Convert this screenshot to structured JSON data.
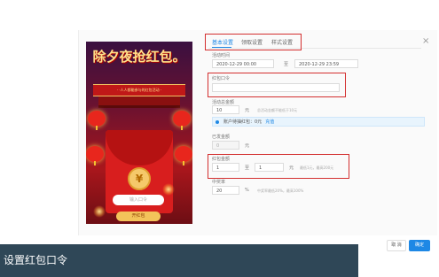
{
  "preview": {
    "title": "除夕夜抢红包。",
    "ribbon_text": "· ·人人都能参与的红包活动 ·",
    "coin_symbol": "¥",
    "password_placeholder": "输入口令",
    "open_button": "开红包"
  },
  "tabs": [
    {
      "label": "基本设置",
      "active": true
    },
    {
      "label": "领取设置",
      "active": false
    },
    {
      "label": "样式设置",
      "active": false
    }
  ],
  "form": {
    "activity_time": {
      "label": "活动时间",
      "start": "2020-12-29 00:00",
      "separator": "至",
      "end": "2020-12-29 23:59"
    },
    "red_packet_password": {
      "label": "红包口令",
      "value": ""
    },
    "activity_amount": {
      "label": "活动总金额",
      "value": "10",
      "unit": "元",
      "hint": "总活动金额不能低于10元"
    },
    "account_info": {
      "text": "账户待抽红包：0元",
      "link": "充值"
    },
    "issued_amount": {
      "label": "已发金额",
      "value": "0",
      "unit": "元"
    },
    "red_packet_amount": {
      "label": "红包金额",
      "min": "1",
      "separator": "至",
      "max": "1",
      "unit": "元",
      "hint": "最低1元，最高200元"
    },
    "win_rate": {
      "label": "中奖率",
      "value": "20",
      "unit": "%",
      "hint": "中奖率最低20%，最高100%"
    }
  },
  "buttons": {
    "cancel": "取 消",
    "ok": "确定"
  },
  "close_symbol": "×",
  "caption": "设置红包口令",
  "colors": {
    "accent": "#1e88e5",
    "highlight_box": "#d32f2f",
    "caption_bg": "#2f4757"
  }
}
